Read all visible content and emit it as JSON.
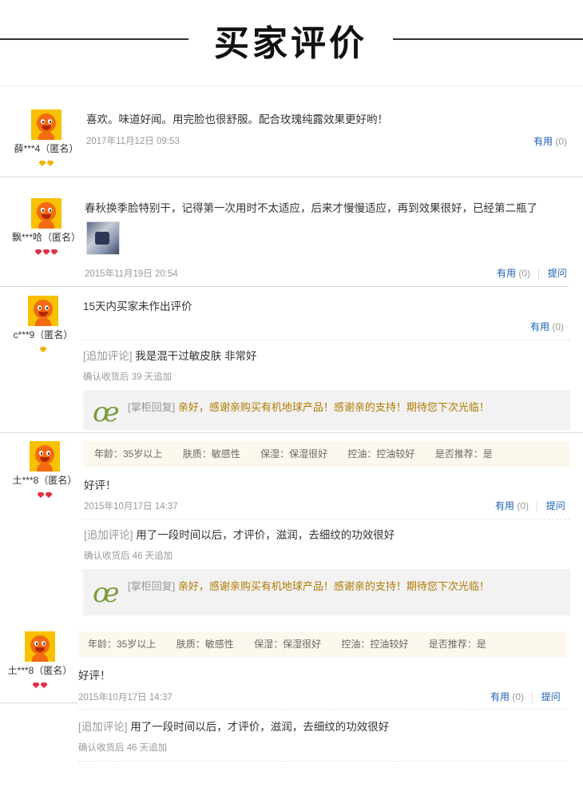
{
  "header": {
    "title": "买家评价"
  },
  "reviews": [
    {
      "user": "薛***4（匿名）",
      "badge_colors": [
        "gold",
        "gold"
      ],
      "content": "喜欢。味道好闻。用完脸也很舒服。配合玫瑰纯露效果更好哟！",
      "date": "2017年11月12日 09:53",
      "useful_label": "有用",
      "useful_count": "(0)"
    },
    {
      "user": "飘***哈（匿名）",
      "badge_colors": [
        "red",
        "red",
        "red"
      ],
      "content": "春秋换季脸特别干，记得第一次用时不太适应，后来才慢慢适应，再到效果很好，已经第二瓶了",
      "date": "2015年11月19日 20:54",
      "useful_label": "有用",
      "useful_count": "(0)",
      "ask_label": "提问"
    },
    {
      "user": "c***9（匿名）",
      "badge_colors": [
        "gold"
      ],
      "content": "15天内买家未作出评价",
      "useful_label": "有用",
      "useful_count": "(0)",
      "append_tag": "[追加评论]",
      "append_text": "我是混干过敏皮肤 非常好",
      "append_time": "确认收货后 39 天追加",
      "reply_tag": "[掌柜回复]",
      "reply_text": "亲好，感谢亲购买有机地球产品！感谢亲的支持！期待您下次光临！"
    },
    {
      "user": "土***8（匿名）",
      "badge_colors": [
        "red",
        "red"
      ],
      "attrs": [
        "年龄：35岁以上",
        "肤质：敏感性",
        "保湿：保湿很好",
        "控油：控油较好",
        "是否推荐：是"
      ],
      "content": "好评！",
      "date": "2015年10月17日 14:37",
      "useful_label": "有用",
      "useful_count": "(0)",
      "ask_label": "提问",
      "append_tag": "[追加评论]",
      "append_text": "用了一段时间以后，才评价，滋润，去细纹的功效很好",
      "append_time": "确认收货后 46 天追加",
      "reply_tag": "[掌柜回复]",
      "reply_text": "亲好，感谢亲购买有机地球产品！感谢亲的支持！期待您下次光临！"
    },
    {
      "user": "土***8（匿名）",
      "badge_colors": [
        "red",
        "red"
      ],
      "attrs": [
        "年龄：35岁以上",
        "肤质：敏感性",
        "保湿：保湿很好",
        "控油：控油较好",
        "是否推荐：是"
      ],
      "content": "好评！",
      "date": "2015年10月17日 14:37",
      "useful_label": "有用",
      "useful_count": "(0)",
      "ask_label": "提问",
      "append_tag": "[追加评论]",
      "append_text": "用了一段时间以后，才评价，滋润，去细纹的功效很好",
      "append_time": "确认收货后 46 天追加"
    }
  ]
}
